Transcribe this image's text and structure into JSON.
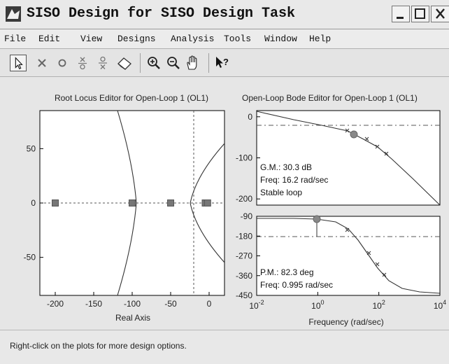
{
  "window": {
    "title": "SISO Design for SISO Design Task"
  },
  "menu": [
    "File",
    "Edit",
    "View",
    "Designs",
    "Analysis",
    "Tools",
    "Window",
    "Help"
  ],
  "toolbar_icons": [
    "select-arrow-icon",
    "add-pole-icon",
    "add-zero-icon",
    "add-lead-icon",
    "add-lag-icon",
    "eraser-icon",
    "zoom-in-icon",
    "zoom-out-icon",
    "pan-hand-icon",
    "context-help-icon"
  ],
  "chart_data": [
    {
      "type": "scatter",
      "title": "Root Locus Editor for Open-Loop 1 (OL1)",
      "xlabel": "Real Axis",
      "ylabel": "",
      "xlim": [
        -220,
        20
      ],
      "ylim": [
        -85,
        85
      ],
      "x_ticks": [
        "-200",
        "-150",
        "-100",
        "-50",
        "0"
      ],
      "y_ticks": [
        "50",
        "0",
        "-50"
      ],
      "poles_real_axis": [
        -200,
        -100,
        -50,
        -5,
        -2
      ],
      "grid": false
    },
    {
      "type": "line",
      "title": "Open-Loop Bode Editor for Open-Loop 1 (OL1)",
      "subplot": "magnitude",
      "ylim": [
        -215,
        15
      ],
      "y_ticks": [
        "0",
        "-100",
        "-200"
      ],
      "x_scale": "log",
      "xlim": [
        0.01,
        10000
      ],
      "annotations": [
        "G.M.: 30.3 dB",
        "Freq: 16.2 rad/sec",
        "Stable loop"
      ],
      "series": [
        {
          "x": [
            0.01,
            0.1,
            1,
            10,
            16.2,
            50,
            100,
            1000
          ],
          "values": [
            15,
            8,
            2,
            -15,
            -22,
            -45,
            -60,
            -130
          ]
        }
      ]
    },
    {
      "type": "line",
      "subplot": "phase",
      "xlabel": "Frequency (rad/sec)",
      "ylim": [
        -450,
        -90
      ],
      "y_ticks": [
        "-90",
        "-180",
        "-270",
        "-360",
        "-450"
      ],
      "x_scale": "log",
      "xlim": [
        0.01,
        10000
      ],
      "x_ticks": [
        "10^-2",
        "10^0",
        "10^2",
        "10^4"
      ],
      "annotations": [
        "P.M.: 82.3 deg",
        "Freq: 0.995 rad/sec"
      ],
      "series": [
        {
          "x": [
            0.01,
            0.1,
            1,
            10,
            100,
            1000,
            10000
          ],
          "values": [
            -90,
            -91,
            -98,
            -150,
            -300,
            -420,
            -445
          ]
        }
      ]
    }
  ],
  "status": "Right-click on the plots for more design options."
}
